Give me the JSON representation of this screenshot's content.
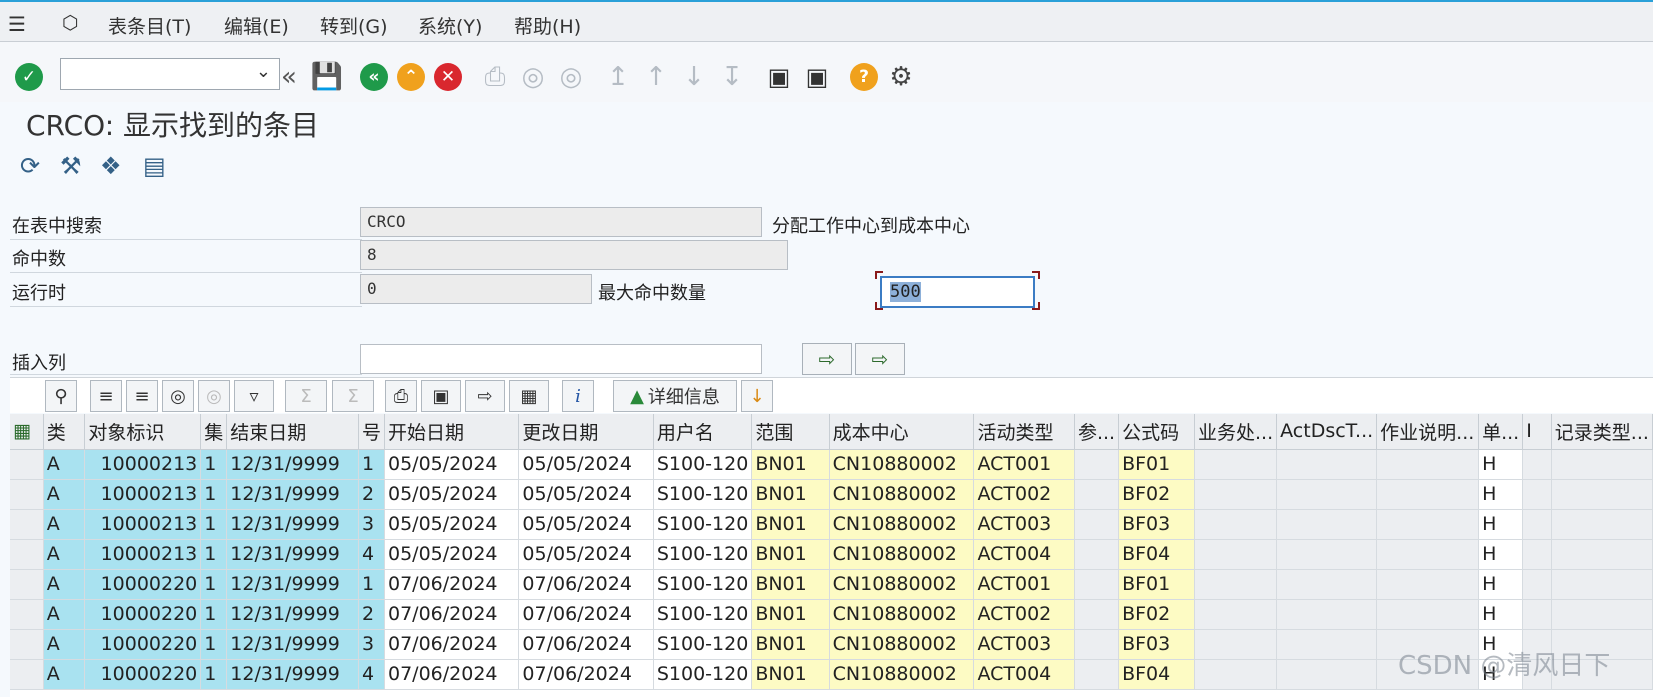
{
  "menu": [
    "表条目(T)",
    "编辑(E)",
    "转到(G)",
    "系统(Y)",
    "帮助(H)"
  ],
  "title": "CRCO: 显示找到的条目",
  "form": {
    "search_label": "在表中搜索",
    "search_value": "CRCO",
    "search_desc": "分配工作中心到成本中心",
    "hits_label": "命中数",
    "hits_value": "8",
    "runtime_label": "运行时",
    "runtime_value": "0",
    "max_label": "最大命中数量",
    "max_value": "500",
    "insert_label": "插入列"
  },
  "alv": {
    "details_label": "详细信息"
  },
  "columns": [
    "类",
    "对象标识",
    "集",
    "结束日期",
    "号",
    "开始日期",
    "更改日期",
    "用户名",
    "范围",
    "成本中心",
    "活动类型",
    "参...",
    "公式码",
    "业务处...",
    "ActDscT...",
    "作业说明...",
    "单...",
    "I",
    "记录类型..."
  ],
  "rows": [
    [
      "A",
      "10000213",
      "1",
      "12/31/9999",
      "1",
      "05/05/2024",
      "05/05/2024",
      "S100-120",
      "BN01",
      "CN10880002",
      "ACT001",
      "",
      "BF01",
      "",
      "",
      "",
      "H",
      "",
      ""
    ],
    [
      "A",
      "10000213",
      "1",
      "12/31/9999",
      "2",
      "05/05/2024",
      "05/05/2024",
      "S100-120",
      "BN01",
      "CN10880002",
      "ACT002",
      "",
      "BF02",
      "",
      "",
      "",
      "H",
      "",
      ""
    ],
    [
      "A",
      "10000213",
      "1",
      "12/31/9999",
      "3",
      "05/05/2024",
      "05/05/2024",
      "S100-120",
      "BN01",
      "CN10880002",
      "ACT003",
      "",
      "BF03",
      "",
      "",
      "",
      "H",
      "",
      ""
    ],
    [
      "A",
      "10000213",
      "1",
      "12/31/9999",
      "4",
      "05/05/2024",
      "05/05/2024",
      "S100-120",
      "BN01",
      "CN10880002",
      "ACT004",
      "",
      "BF04",
      "",
      "",
      "",
      "H",
      "",
      ""
    ],
    [
      "A",
      "10000220",
      "1",
      "12/31/9999",
      "1",
      "07/06/2024",
      "07/06/2024",
      "S100-120",
      "BN01",
      "CN10880002",
      "ACT001",
      "",
      "BF01",
      "",
      "",
      "",
      "H",
      "",
      ""
    ],
    [
      "A",
      "10000220",
      "1",
      "12/31/9999",
      "2",
      "07/06/2024",
      "07/06/2024",
      "S100-120",
      "BN01",
      "CN10880002",
      "ACT002",
      "",
      "BF02",
      "",
      "",
      "",
      "H",
      "",
      ""
    ],
    [
      "A",
      "10000220",
      "1",
      "12/31/9999",
      "3",
      "07/06/2024",
      "07/06/2024",
      "S100-120",
      "BN01",
      "CN10880002",
      "ACT003",
      "",
      "BF03",
      "",
      "",
      "",
      "H",
      "",
      ""
    ],
    [
      "A",
      "10000220",
      "1",
      "12/31/9999",
      "4",
      "07/06/2024",
      "07/06/2024",
      "S100-120",
      "BN01",
      "CN10880002",
      "ACT004",
      "",
      "BF04",
      "",
      "",
      "",
      "H",
      "",
      ""
    ]
  ],
  "watermark": "CSDN @清风日下",
  "colors": {
    "key": "#a9e2f0",
    "yellow": "#fdfbc4",
    "accent": "#2aa0d8",
    "green": "#1f9a4a",
    "orange": "#f0a11d",
    "red": "#d9272e"
  }
}
